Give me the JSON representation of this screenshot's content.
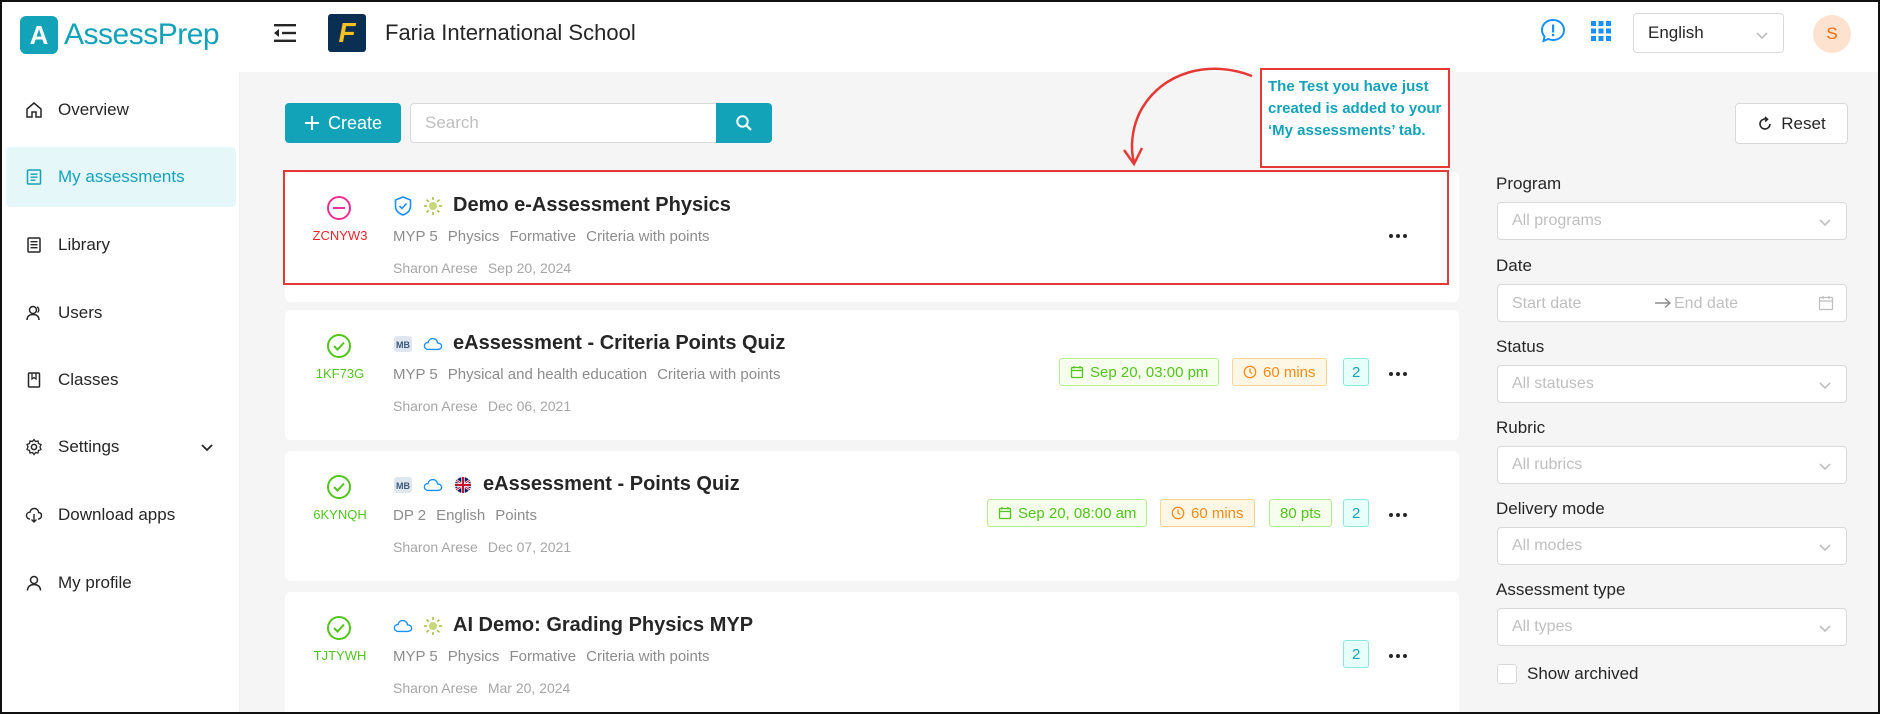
{
  "header": {
    "logo_letter": "A",
    "app_name": "AssessPrep",
    "school_logo_letter": "F",
    "school_name": "Faria International School",
    "language": "English",
    "avatar_initial": "S",
    "icons": [
      "menu-fold-icon",
      "feedback-icon",
      "apps-grid-icon",
      "chevron-down-icon"
    ]
  },
  "sidebar": {
    "items": [
      {
        "label": "Overview",
        "icon": "home-icon",
        "active": false
      },
      {
        "label": "My assessments",
        "icon": "list-icon",
        "active": true
      },
      {
        "label": "Library",
        "icon": "library-icon",
        "active": false
      },
      {
        "label": "Users",
        "icon": "users-icon",
        "active": false
      },
      {
        "label": "Classes",
        "icon": "book-icon",
        "active": false
      },
      {
        "label": "Settings",
        "icon": "gear-icon",
        "active": false
      },
      {
        "label": "Download apps",
        "icon": "cloud-download-icon",
        "active": false
      },
      {
        "label": "My profile",
        "icon": "user-icon",
        "active": false
      }
    ]
  },
  "toolbar": {
    "create_label": "Create",
    "search_placeholder": "Search"
  },
  "assessments": [
    {
      "status": "draft",
      "code": "ZCNYW3",
      "title": "Demo e-Assessment Physics",
      "meta": [
        "MYP 5",
        "Physics",
        "Formative",
        "Criteria with points"
      ],
      "author": "Sharon Arese",
      "date": "Sep 20, 2024",
      "tags": {}
    },
    {
      "status": "published",
      "code": "1KF73G",
      "title": "eAssessment - Criteria Points Quiz",
      "meta": [
        "MYP 5",
        "Physical and health education",
        "Criteria with points"
      ],
      "author": "Sharon Arese",
      "date": "Dec 06, 2021",
      "tags": {
        "date": "Sep 20, 03:00 pm",
        "duration": "60 mins",
        "count": "2"
      }
    },
    {
      "status": "published",
      "code": "6KYNQH",
      "title": "eAssessment - Points Quiz",
      "meta": [
        "DP 2",
        "English",
        "Points"
      ],
      "author": "Sharon Arese",
      "date": "Dec 07, 2021",
      "tags": {
        "date": "Sep 20, 08:00 am",
        "duration": "60 mins",
        "points": "80 pts",
        "count": "2"
      }
    },
    {
      "status": "published",
      "code": "TJTYWH",
      "title": "AI Demo: Grading Physics MYP",
      "meta": [
        "MYP 5",
        "Physics",
        "Formative",
        "Criteria with points"
      ],
      "author": "Sharon Arese",
      "date": "Mar 20, 2024",
      "tags": {
        "count": "2"
      }
    }
  ],
  "annotation": {
    "note": "The Test you have just created is added to your ‘My assessments’ tab."
  },
  "filters": {
    "reset_label": "Reset",
    "program_label": "Program",
    "program_placeholder": "All programs",
    "date_label": "Date",
    "start_placeholder": "Start date",
    "end_placeholder": "End date",
    "status_label": "Status",
    "status_placeholder": "All statuses",
    "rubric_label": "Rubric",
    "rubric_placeholder": "All rubrics",
    "delivery_label": "Delivery mode",
    "delivery_placeholder": "All modes",
    "type_label": "Assessment type",
    "type_placeholder": "All types",
    "archived_label": "Show archived"
  },
  "colors": {
    "brand": "#13a3b8",
    "annotation_red": "#e53935",
    "success": "#52c41a",
    "draft": "#eb2f96",
    "warning": "#fa8c16"
  }
}
